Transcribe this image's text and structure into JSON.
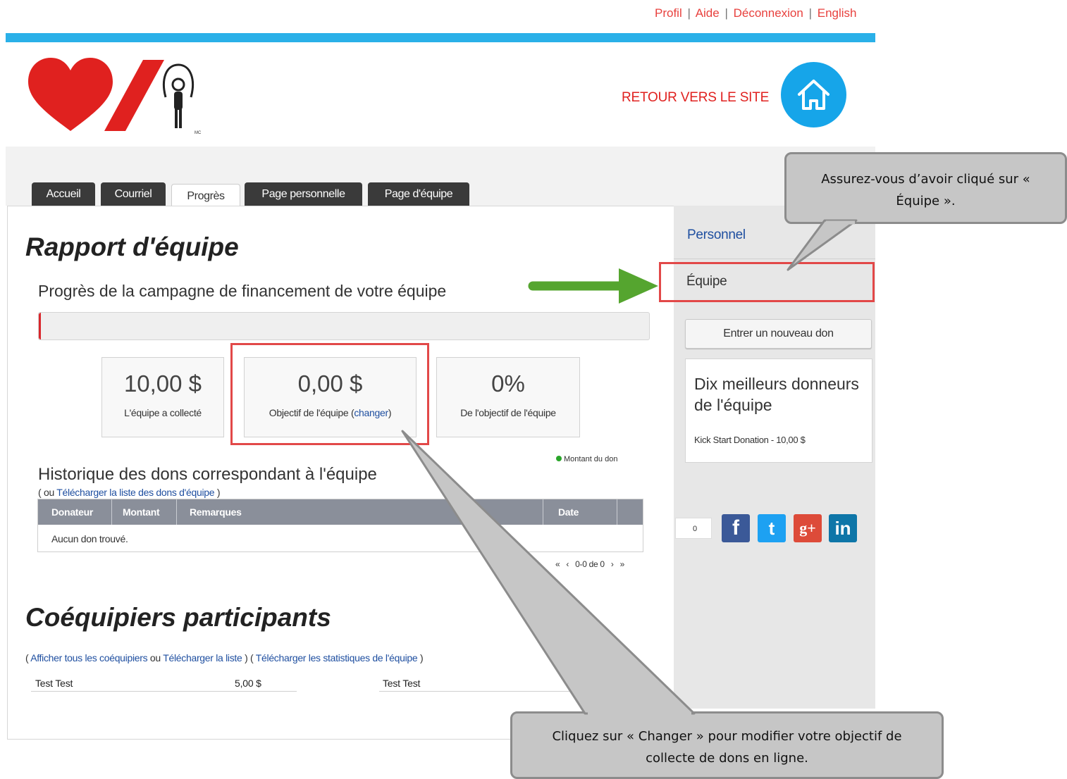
{
  "top_links": {
    "profil": "Profil",
    "aide": "Aide",
    "deconnexion": "Déconnexion",
    "english": "English",
    "separator": "|"
  },
  "header": {
    "back_to_site": "RETOUR VERS LE SITE",
    "logo_mark": "MC"
  },
  "tabs": [
    {
      "label": "Accueil"
    },
    {
      "label": "Courriel"
    },
    {
      "label": "Progrès"
    },
    {
      "label": "Page personnelle"
    },
    {
      "label": "Page d'équipe"
    }
  ],
  "main": {
    "title": "Rapport d'équipe",
    "progress_title": "Progrès de la campagne de financement de votre équipe",
    "progress_fraction": 0,
    "stats": {
      "collected_value": "10,00 $",
      "collected_label": "L'équipe a collecté",
      "goal_value": "0,00 $",
      "goal_label_prefix": "Objectif de l'équipe (",
      "goal_change_link": "changer",
      "goal_label_suffix": ")",
      "percent_value": "0%",
      "percent_label": "De l'objectif de l'équipe"
    },
    "legend": "Montant du don",
    "history_title": "Historique des dons correspondant à l'équipe",
    "history_sub_prefix": "( ou ",
    "history_sub_link": "Télécharger la liste des dons d'équipe",
    "history_sub_suffix": " )",
    "table": {
      "headers": [
        "Donateur",
        "Montant",
        "Remarques",
        "Date"
      ],
      "empty": "Aucun don trouvé."
    },
    "pager": {
      "first": "«",
      "prev": "‹",
      "range": "0-0 de 0",
      "next": "›",
      "last": "»"
    },
    "teammates_title": "Coéquipiers participants",
    "teammates_links": {
      "open1": "( ",
      "show_all": "Afficher tous les coéquipiers",
      "ou": " ou ",
      "download_list": "Télécharger la liste",
      "close_open": " ) ( ",
      "download_stats": "Télécharger les statistiques de l'équipe",
      "close2": " )"
    },
    "teammates": [
      {
        "name": "Test Test",
        "amount": "5,00 $"
      },
      {
        "name": "Test Test",
        "amount": ""
      }
    ]
  },
  "sidebar": {
    "personnel": "Personnel",
    "equipe": "Équipe",
    "new_donation": "Entrer un nouveau don",
    "top_donors_title": "Dix meilleurs donneurs de l'équipe",
    "top_donors_entry": "Kick Start Donation - 10,00 $",
    "share_count": "0",
    "social": [
      {
        "icon": "facebook-icon",
        "glyph": "f",
        "color": "#3b5998"
      },
      {
        "icon": "twitter-icon",
        "glyph": "t",
        "color": "#1da1f2"
      },
      {
        "icon": "google-plus-icon",
        "glyph": "g+",
        "color": "#dd4b39"
      },
      {
        "icon": "linkedin-icon",
        "glyph": "in",
        "color": "#0e76a8"
      }
    ]
  },
  "callouts": {
    "top": "Assurez-vous d’avoir cliqué sur « Équipe ».",
    "bottom": "Cliquez sur « Changer » pour modifier votre objectif de collecte de dons en ligne."
  },
  "colors": {
    "brand_red": "#e0211f",
    "brand_blue": "#16a5e9",
    "annotation_red": "#e24848",
    "arrow_green": "#55a52f"
  }
}
